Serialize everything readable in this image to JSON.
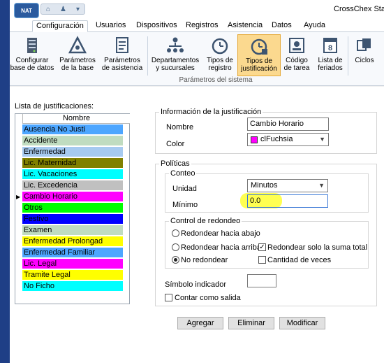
{
  "app": {
    "logo_text": "NAT",
    "title": "CrossChex Standa"
  },
  "quick_access": {
    "icons": [
      "home-icon",
      "users-icon",
      "dropdown-icon"
    ]
  },
  "tabs": [
    {
      "label": "Configuración",
      "active": true
    },
    {
      "label": "Usuarios"
    },
    {
      "label": "Dispositivos"
    },
    {
      "label": "Registros"
    },
    {
      "label": "Asistencia"
    },
    {
      "label": "Datos"
    },
    {
      "label": "Ayuda"
    }
  ],
  "ribbon": {
    "group_label": "Parámetros del sistema",
    "buttons": [
      {
        "label": "Configurar\nbase de datos",
        "icon": "database-icon"
      },
      {
        "label": "Parámetros\nde la base",
        "icon": "settings-icon"
      },
      {
        "label": "Parámetros\nde asistencia",
        "icon": "attendance-params-icon"
      },
      {
        "label": "Departamentos\ny sucursales",
        "icon": "org-chart-icon"
      },
      {
        "label": "Tipos de\nregistro",
        "icon": "clock-icon"
      },
      {
        "label": "Tipos de\njustificación",
        "icon": "justification-clock-icon",
        "selected": true
      },
      {
        "label": "Código\nde tarea",
        "icon": "task-code-icon"
      },
      {
        "label": "Lista de\nferiados",
        "icon": "calendar-icon",
        "badge": "8"
      },
      {
        "label": "Ciclos",
        "icon": "cycles-icon"
      }
    ]
  },
  "list": {
    "label": "Lista de justificaciones:",
    "column_header": "Nombre",
    "selected_index": 6,
    "items": [
      {
        "name": "Ausencia No Justi",
        "color": "#4da6ff"
      },
      {
        "name": "Accidente",
        "color": "#c0dcc0"
      },
      {
        "name": "Enfermedad",
        "color": "#a6caf0"
      },
      {
        "name": "Lic. Maternidad",
        "color": "#808000"
      },
      {
        "name": "Lic. Vacaciones",
        "color": "#00ffff"
      },
      {
        "name": "Lic. Excedencia",
        "color": "#c0c0c0"
      },
      {
        "name": "Cambio Horario",
        "color": "#ff00ff"
      },
      {
        "name": "Otros",
        "color": "#00ff00"
      },
      {
        "name": "Festivo",
        "color": "#0000ff"
      },
      {
        "name": "Examen",
        "color": "#c0dcc0"
      },
      {
        "name": "Enfermedad Prolongad",
        "color": "#ffff00"
      },
      {
        "name": "Enfermedad Familiar",
        "color": "#4da6ff"
      },
      {
        "name": "Lic. Legal",
        "color": "#ff00ff"
      },
      {
        "name": "Tramite Legal",
        "color": "#ffff00"
      },
      {
        "name": "No Ficho",
        "color": "#00ffff"
      }
    ]
  },
  "info": {
    "legend": "Información de la justificación",
    "name_label": "Nombre",
    "name_value": "Cambio Horario",
    "color_label": "Color",
    "color_value": "clFuchsia",
    "color_swatch": "#ff00ff"
  },
  "policies": {
    "legend": "Políticas",
    "count": {
      "legend": "Conteo",
      "unit_label": "Unidad",
      "unit_value": "Minutos",
      "min_label": "Mínimo",
      "min_value": "0.0"
    },
    "rounding": {
      "legend": "Control de redondeo",
      "options": [
        {
          "label": "Redondear hacia abajo",
          "checked": false
        },
        {
          "label": "Redondear hacia arriba",
          "checked": false
        },
        {
          "label": "No redondear",
          "checked": true
        }
      ],
      "checks": [
        {
          "label": "Redondear solo la suma total",
          "checked": true
        },
        {
          "label": "Cantidad de veces",
          "checked": false
        }
      ]
    },
    "symbol_label": "Símbolo indicador",
    "symbol_value": "",
    "count_as_exit_label": "Contar como salida",
    "count_as_exit_checked": false
  },
  "actions": {
    "add": "Agregar",
    "delete": "Eliminar",
    "modify": "Modificar"
  },
  "highlight_color": "#ffff33"
}
